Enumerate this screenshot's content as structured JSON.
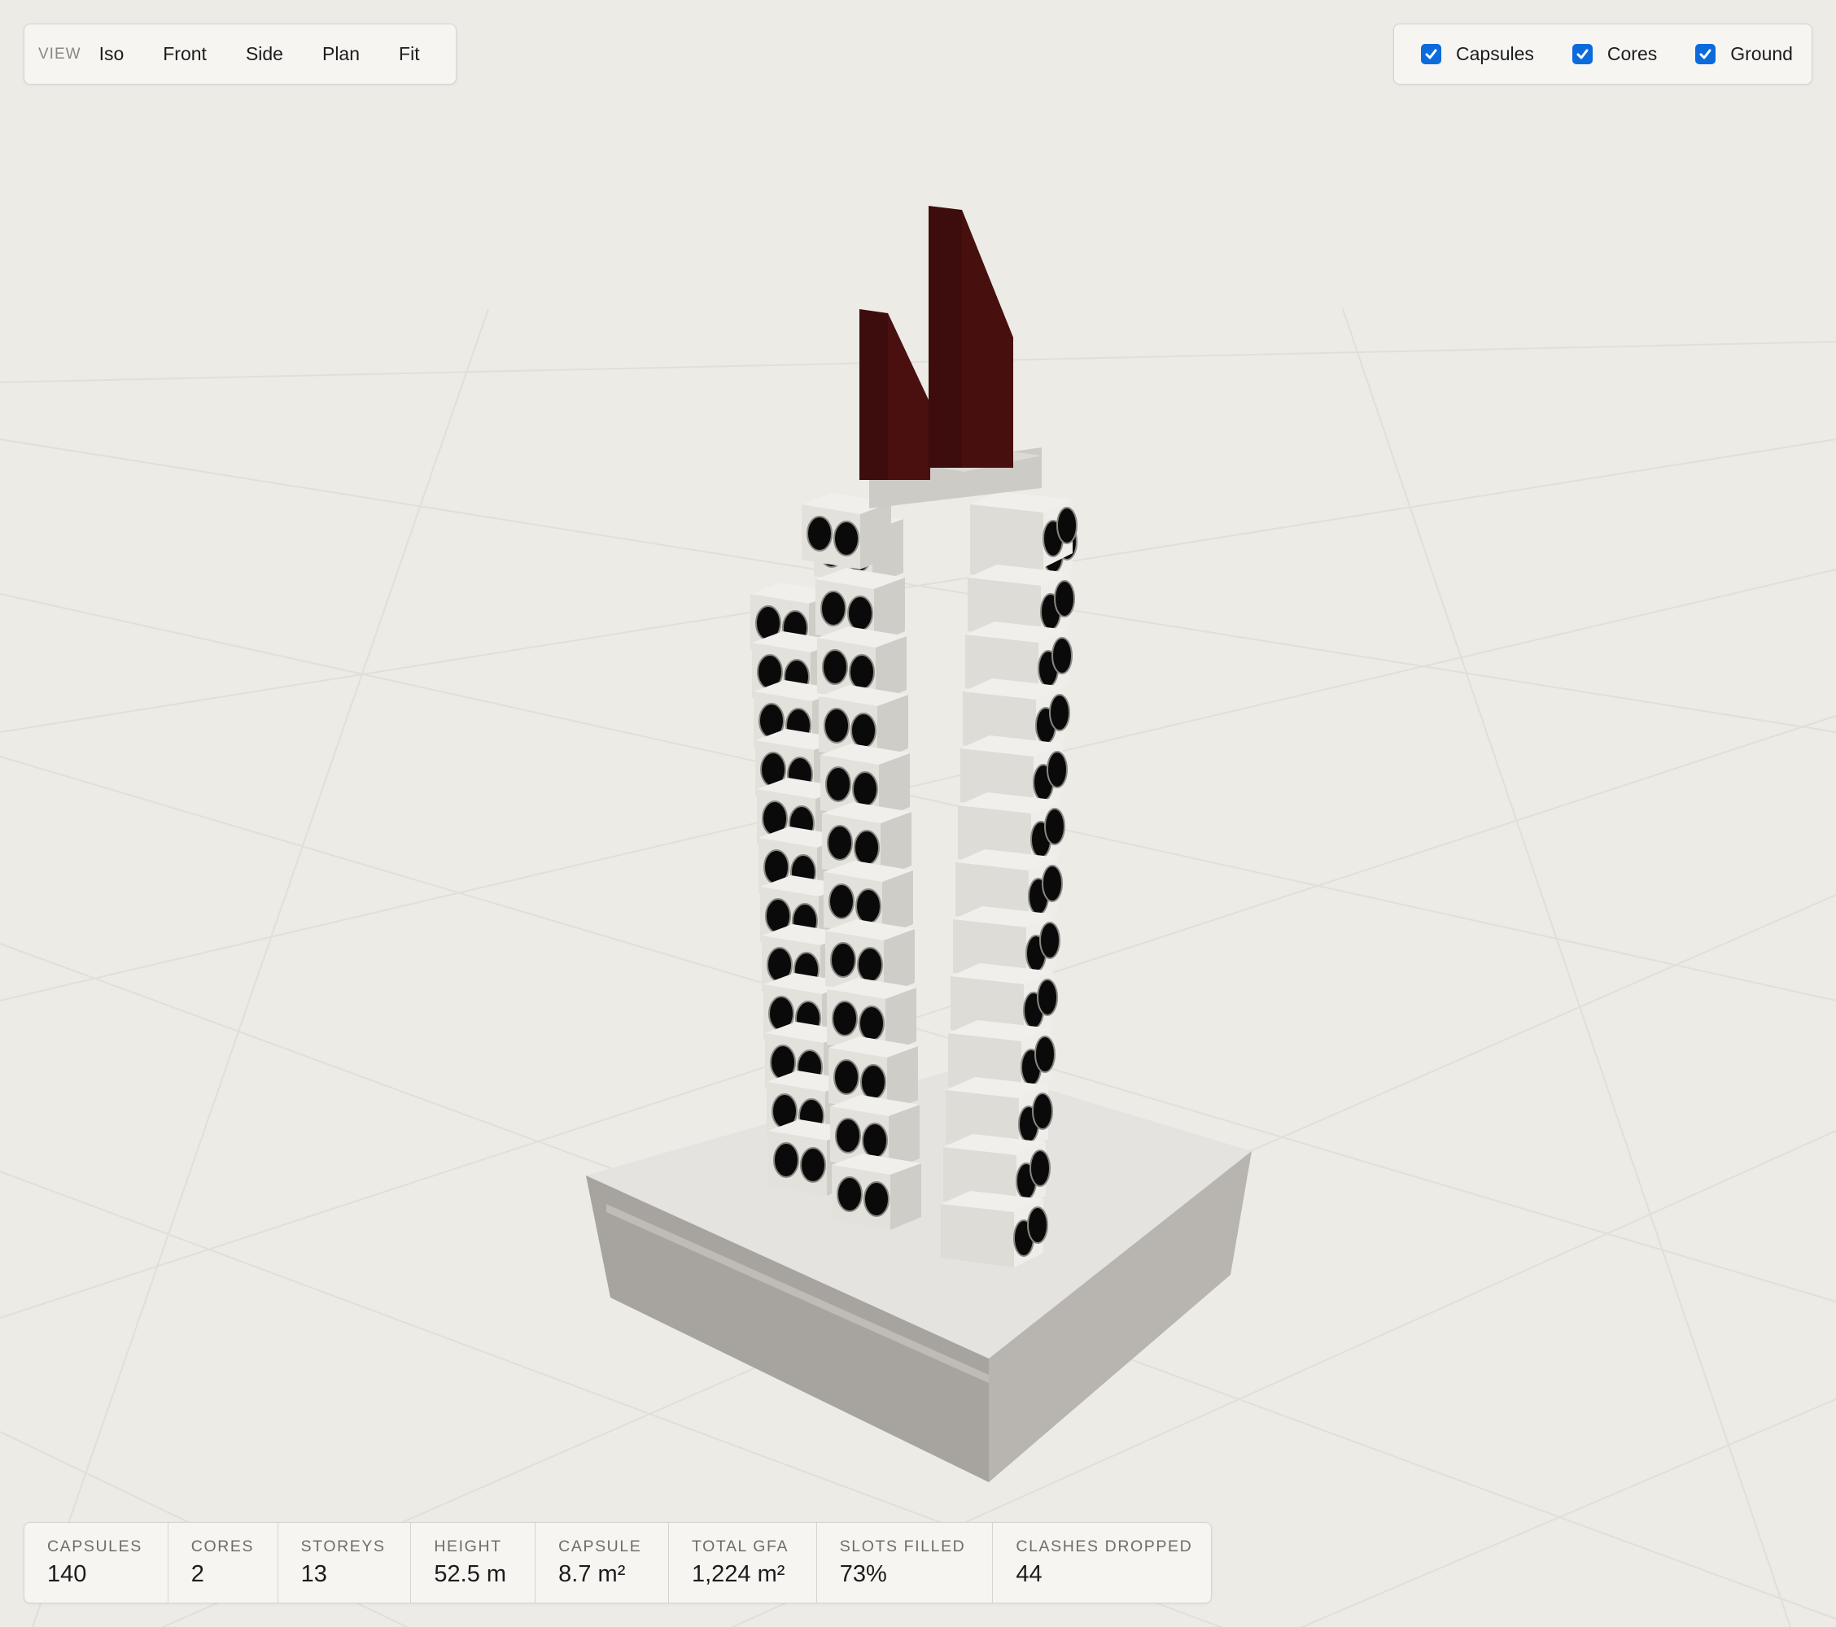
{
  "toolbar": {
    "label": "VIEW",
    "buttons": [
      "Iso",
      "Front",
      "Side",
      "Plan",
      "Fit"
    ]
  },
  "layers": [
    {
      "label": "Capsules",
      "checked": true
    },
    {
      "label": "Cores",
      "checked": true
    },
    {
      "label": "Ground",
      "checked": true
    }
  ],
  "stats": [
    {
      "label": "CAPSULES",
      "value": "140"
    },
    {
      "label": "CORES",
      "value": "2"
    },
    {
      "label": "STOREYS",
      "value": "13"
    },
    {
      "label": "HEIGHT",
      "value": "52.5 m"
    },
    {
      "label": "CAPSULE",
      "value": "8.7 m²"
    },
    {
      "label": "TOTAL GFA",
      "value": "1,224 m²"
    },
    {
      "label": "SLOTS FILLED",
      "value": "73%"
    },
    {
      "label": "CLASHES DROPPED",
      "value": "44"
    }
  ],
  "colors": {
    "background": "#ecebe6",
    "checkbox": "#0b6bdc",
    "core_crown": "#3d0c0c",
    "capsule": "#e6e4de",
    "porthole": "#0a0a0a",
    "plinth_top": "#e4e3e0"
  }
}
